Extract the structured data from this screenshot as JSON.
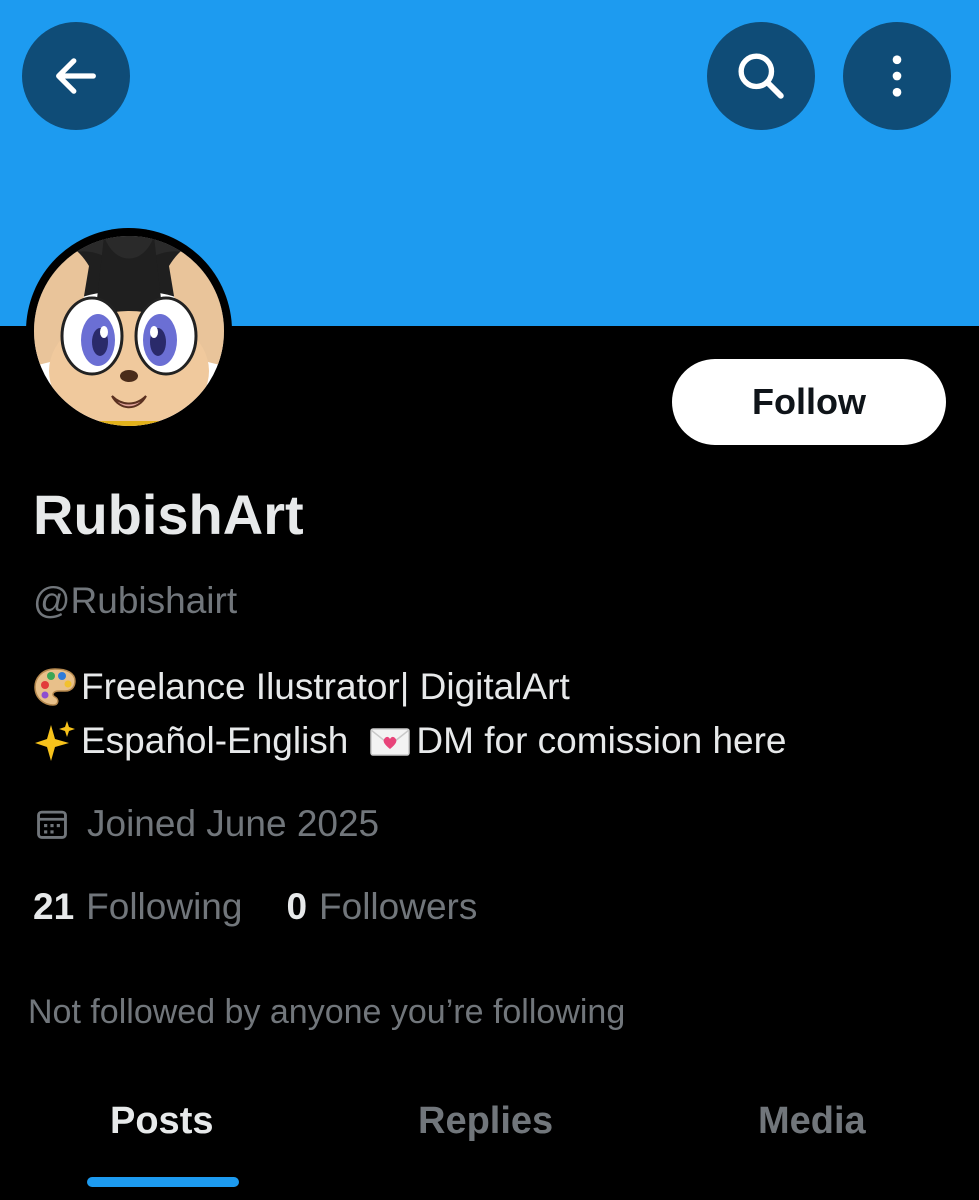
{
  "colors": {
    "banner": "#1d9bf0",
    "accent": "#1d9bf0",
    "background": "#000000",
    "icon_button": "#0f4c77",
    "secondary_text": "#71767b"
  },
  "header": {
    "back_icon": "arrow-left-icon",
    "search_icon": "search-icon",
    "more_icon": "more-vertical-icon"
  },
  "profile": {
    "display_name": "RubishArt",
    "handle": "@Rubishairt",
    "follow_label": "Follow",
    "bio_line1": "Freelance Ilustrator| DigitalArt",
    "bio_line2_a": "Español-English",
    "bio_line2_b": "DM for comission here",
    "joined": "Joined June 2025",
    "following_count": "21",
    "following_label": "Following",
    "followers_count": "0",
    "followers_label": "Followers",
    "not_followed": "Not followed by anyone you’re following"
  },
  "tabs": [
    {
      "label": "Posts",
      "active": true
    },
    {
      "label": "Replies",
      "active": false
    },
    {
      "label": "Media",
      "active": false
    }
  ]
}
